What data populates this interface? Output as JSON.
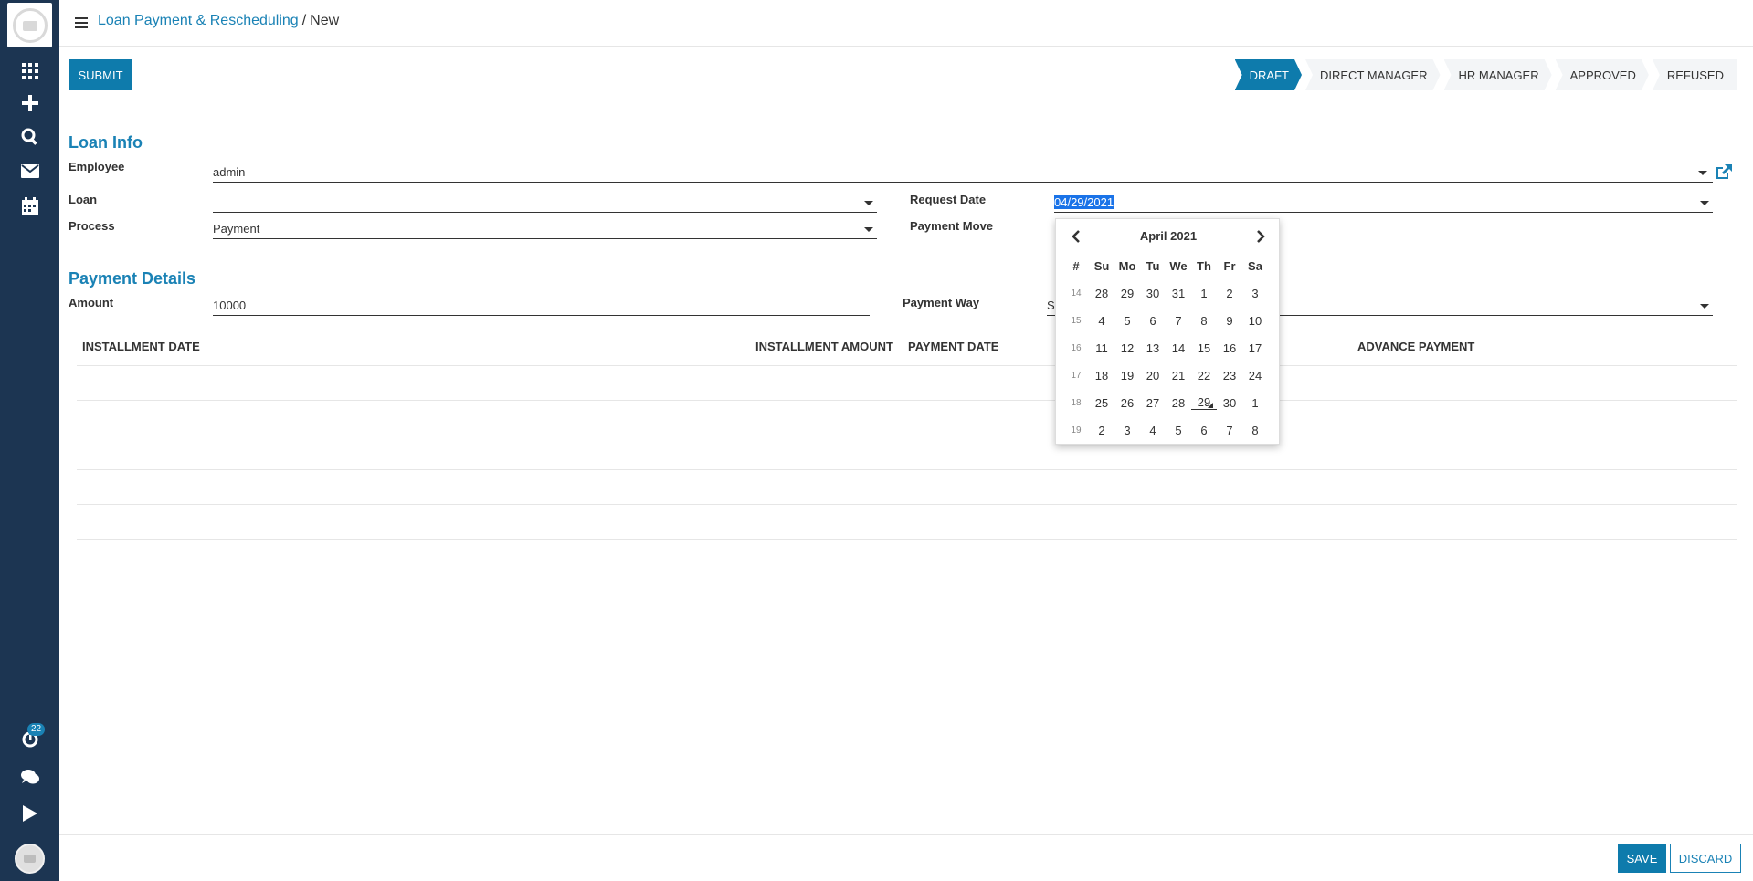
{
  "breadcrumb": {
    "parent": "Loan Payment & Rescheduling",
    "separator": "/",
    "current": "New"
  },
  "toolbar": {
    "submit_label": "SUBMIT"
  },
  "stages": [
    "DRAFT",
    "DIRECT MANAGER",
    "HR MANAGER",
    "APPROVED",
    "REFUSED"
  ],
  "loan_info": {
    "title": "Loan Info",
    "employee_label": "Employee",
    "employee_value": "admin",
    "loan_label": "Loan",
    "loan_value": "",
    "process_label": "Process",
    "process_value": "Payment",
    "request_date_label": "Request Date",
    "request_date_value": "04/29/2021",
    "payment_move_label": "Payment Move"
  },
  "payment_details": {
    "title": "Payment Details",
    "amount_label": "Amount",
    "amount_value": "10000",
    "payment_way_label": "Payment Way",
    "payment_way_value": "S"
  },
  "table": {
    "headers": [
      "INSTALLMENT DATE",
      "INSTALLMENT AMOUNT",
      "PAYMENT DATE",
      "ADVANCE PAYMENT"
    ]
  },
  "datepicker": {
    "title": "April 2021",
    "headers": [
      "#",
      "Su",
      "Mo",
      "Tu",
      "We",
      "Th",
      "Fr",
      "Sa"
    ],
    "weeks": [
      {
        "wk": "14",
        "days": [
          "28",
          "29",
          "30",
          "31",
          "1",
          "2",
          "3"
        ]
      },
      {
        "wk": "15",
        "days": [
          "4",
          "5",
          "6",
          "7",
          "8",
          "9",
          "10"
        ]
      },
      {
        "wk": "16",
        "days": [
          "11",
          "12",
          "13",
          "14",
          "15",
          "16",
          "17"
        ]
      },
      {
        "wk": "17",
        "days": [
          "18",
          "19",
          "20",
          "21",
          "22",
          "23",
          "24"
        ]
      },
      {
        "wk": "18",
        "days": [
          "25",
          "26",
          "27",
          "28",
          "29",
          "30",
          "1"
        ]
      },
      {
        "wk": "19",
        "days": [
          "2",
          "3",
          "4",
          "5",
          "6",
          "7",
          "8"
        ]
      }
    ],
    "today": "29"
  },
  "sidebar": {
    "activity_count": "22"
  },
  "footer": {
    "save_label": "SAVE",
    "discard_label": "DISCARD"
  },
  "colors": {
    "sidebar": "#1c3552",
    "primary": "#0e7bac",
    "link": "#1a82b5"
  },
  "icons": [
    "apps-icon",
    "plus-icon",
    "search-icon",
    "mail-icon",
    "calendar-icon",
    "activity-icon",
    "chat-icon",
    "play-icon",
    "external-link-icon"
  ]
}
